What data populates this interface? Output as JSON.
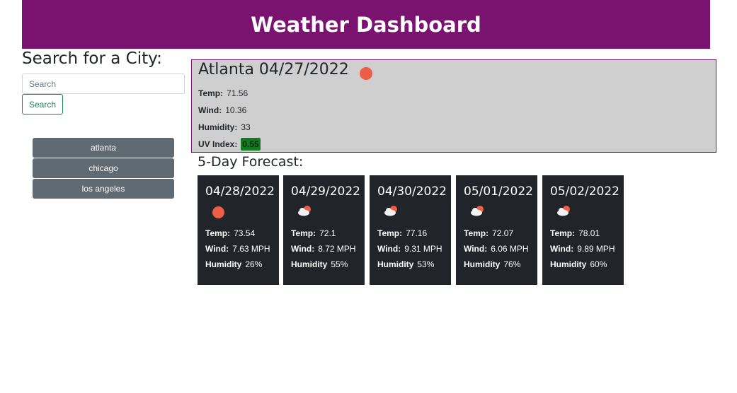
{
  "header": {
    "title": "Weather Dashboard"
  },
  "search": {
    "title": "Search for a City:",
    "placeholder": "Search",
    "button_label": "Search"
  },
  "history": [
    "atlanta",
    "chicago",
    "los angeles"
  ],
  "current": {
    "title": "Atlanta 04/27/2022",
    "icon": "sun-icon",
    "temp_label": "Temp:",
    "temp": "71.56",
    "wind_label": "Wind:",
    "wind": "10.36",
    "humidity_label": "Humidity:",
    "humidity": "33",
    "uv_label": "UV Index:",
    "uv": "0.55",
    "uv_color": "#127a20",
    "border_color": "#7a1270",
    "bg_color": "#cfcfcf"
  },
  "forecast": {
    "title": "5-Day Forecast:",
    "days": [
      {
        "date": "04/28/2022",
        "icon": "sun-icon",
        "temp": "73.54",
        "wind": "7.63 MPH",
        "humidity": "26%"
      },
      {
        "date": "04/29/2022",
        "icon": "cloud-sun-icon",
        "temp": "72.1",
        "wind": "8.72 MPH",
        "humidity": "55%"
      },
      {
        "date": "04/30/2022",
        "icon": "cloud-sun-icon",
        "temp": "77.16",
        "wind": "9.31 MPH",
        "humidity": "53%"
      },
      {
        "date": "05/01/2022",
        "icon": "cloud-sun-icon",
        "temp": "72.07",
        "wind": "6.06 MPH",
        "humidity": "76%"
      },
      {
        "date": "05/02/2022",
        "icon": "cloud-sun-icon",
        "temp": "78.01",
        "wind": "9.89 MPH",
        "humidity": "60%"
      }
    ],
    "labels": {
      "temp": "Temp:",
      "wind": "Wind:",
      "humidity": "Humidity"
    }
  },
  "colors": {
    "header": "#7a1270",
    "card": "#212529",
    "history_button": "#5f6a72",
    "search_button": "#198754",
    "sun": "#ee5d45"
  }
}
